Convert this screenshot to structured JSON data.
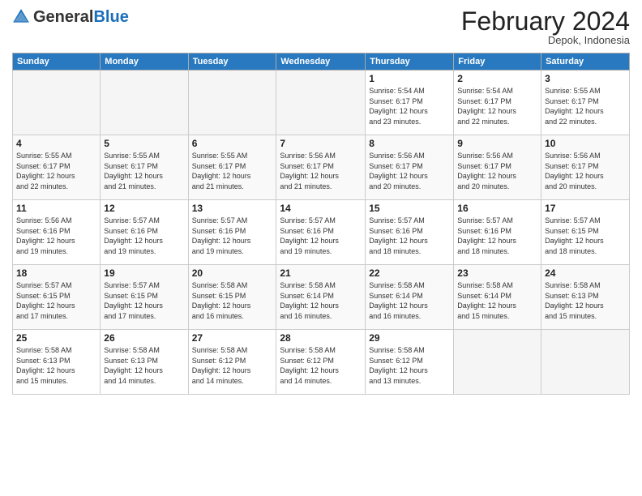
{
  "header": {
    "logo_general": "General",
    "logo_blue": "Blue",
    "month_title": "February 2024",
    "subtitle": "Depok, Indonesia"
  },
  "columns": [
    "Sunday",
    "Monday",
    "Tuesday",
    "Wednesday",
    "Thursday",
    "Friday",
    "Saturday"
  ],
  "weeks": [
    [
      {
        "day": "",
        "detail": ""
      },
      {
        "day": "",
        "detail": ""
      },
      {
        "day": "",
        "detail": ""
      },
      {
        "day": "",
        "detail": ""
      },
      {
        "day": "1",
        "detail": "Sunrise: 5:54 AM\nSunset: 6:17 PM\nDaylight: 12 hours\nand 23 minutes."
      },
      {
        "day": "2",
        "detail": "Sunrise: 5:54 AM\nSunset: 6:17 PM\nDaylight: 12 hours\nand 22 minutes."
      },
      {
        "day": "3",
        "detail": "Sunrise: 5:55 AM\nSunset: 6:17 PM\nDaylight: 12 hours\nand 22 minutes."
      }
    ],
    [
      {
        "day": "4",
        "detail": "Sunrise: 5:55 AM\nSunset: 6:17 PM\nDaylight: 12 hours\nand 22 minutes."
      },
      {
        "day": "5",
        "detail": "Sunrise: 5:55 AM\nSunset: 6:17 PM\nDaylight: 12 hours\nand 21 minutes."
      },
      {
        "day": "6",
        "detail": "Sunrise: 5:55 AM\nSunset: 6:17 PM\nDaylight: 12 hours\nand 21 minutes."
      },
      {
        "day": "7",
        "detail": "Sunrise: 5:56 AM\nSunset: 6:17 PM\nDaylight: 12 hours\nand 21 minutes."
      },
      {
        "day": "8",
        "detail": "Sunrise: 5:56 AM\nSunset: 6:17 PM\nDaylight: 12 hours\nand 20 minutes."
      },
      {
        "day": "9",
        "detail": "Sunrise: 5:56 AM\nSunset: 6:17 PM\nDaylight: 12 hours\nand 20 minutes."
      },
      {
        "day": "10",
        "detail": "Sunrise: 5:56 AM\nSunset: 6:17 PM\nDaylight: 12 hours\nand 20 minutes."
      }
    ],
    [
      {
        "day": "11",
        "detail": "Sunrise: 5:56 AM\nSunset: 6:16 PM\nDaylight: 12 hours\nand 19 minutes."
      },
      {
        "day": "12",
        "detail": "Sunrise: 5:57 AM\nSunset: 6:16 PM\nDaylight: 12 hours\nand 19 minutes."
      },
      {
        "day": "13",
        "detail": "Sunrise: 5:57 AM\nSunset: 6:16 PM\nDaylight: 12 hours\nand 19 minutes."
      },
      {
        "day": "14",
        "detail": "Sunrise: 5:57 AM\nSunset: 6:16 PM\nDaylight: 12 hours\nand 19 minutes."
      },
      {
        "day": "15",
        "detail": "Sunrise: 5:57 AM\nSunset: 6:16 PM\nDaylight: 12 hours\nand 18 minutes."
      },
      {
        "day": "16",
        "detail": "Sunrise: 5:57 AM\nSunset: 6:16 PM\nDaylight: 12 hours\nand 18 minutes."
      },
      {
        "day": "17",
        "detail": "Sunrise: 5:57 AM\nSunset: 6:15 PM\nDaylight: 12 hours\nand 18 minutes."
      }
    ],
    [
      {
        "day": "18",
        "detail": "Sunrise: 5:57 AM\nSunset: 6:15 PM\nDaylight: 12 hours\nand 17 minutes."
      },
      {
        "day": "19",
        "detail": "Sunrise: 5:57 AM\nSunset: 6:15 PM\nDaylight: 12 hours\nand 17 minutes."
      },
      {
        "day": "20",
        "detail": "Sunrise: 5:58 AM\nSunset: 6:15 PM\nDaylight: 12 hours\nand 16 minutes."
      },
      {
        "day": "21",
        "detail": "Sunrise: 5:58 AM\nSunset: 6:14 PM\nDaylight: 12 hours\nand 16 minutes."
      },
      {
        "day": "22",
        "detail": "Sunrise: 5:58 AM\nSunset: 6:14 PM\nDaylight: 12 hours\nand 16 minutes."
      },
      {
        "day": "23",
        "detail": "Sunrise: 5:58 AM\nSunset: 6:14 PM\nDaylight: 12 hours\nand 15 minutes."
      },
      {
        "day": "24",
        "detail": "Sunrise: 5:58 AM\nSunset: 6:13 PM\nDaylight: 12 hours\nand 15 minutes."
      }
    ],
    [
      {
        "day": "25",
        "detail": "Sunrise: 5:58 AM\nSunset: 6:13 PM\nDaylight: 12 hours\nand 15 minutes."
      },
      {
        "day": "26",
        "detail": "Sunrise: 5:58 AM\nSunset: 6:13 PM\nDaylight: 12 hours\nand 14 minutes."
      },
      {
        "day": "27",
        "detail": "Sunrise: 5:58 AM\nSunset: 6:12 PM\nDaylight: 12 hours\nand 14 minutes."
      },
      {
        "day": "28",
        "detail": "Sunrise: 5:58 AM\nSunset: 6:12 PM\nDaylight: 12 hours\nand 14 minutes."
      },
      {
        "day": "29",
        "detail": "Sunrise: 5:58 AM\nSunset: 6:12 PM\nDaylight: 12 hours\nand 13 minutes."
      },
      {
        "day": "",
        "detail": ""
      },
      {
        "day": "",
        "detail": ""
      }
    ]
  ]
}
